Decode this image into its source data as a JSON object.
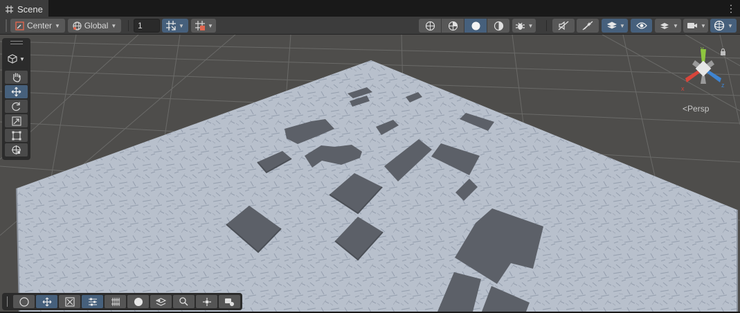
{
  "tab": {
    "label": "Scene",
    "icon": "grid-icon"
  },
  "toolbar": {
    "pivot_label": "Center",
    "space_label": "Global",
    "grid_size_value": "1",
    "icons": [
      "pivot-icon",
      "globe-icon",
      "grid-snap-icon",
      "increment-snap-icon",
      "wireframe-sphere-icon",
      "shaded-wireframe-icon",
      "shaded-sphere-icon",
      "lighting-icon",
      "debug-icon",
      "audio-icon",
      "effects-icon",
      "layers-icon",
      "visibility-icon",
      "overlay-icon",
      "camera-icon",
      "gizmos-icon"
    ]
  },
  "left_tools": [
    "view-tool-hand",
    "move-tool",
    "rotate-tool",
    "scale-tool",
    "rect-tool",
    "transform-tool"
  ],
  "bottom_tools": [
    "navigation-icon",
    "move-icon",
    "scale-icon",
    "align-icon",
    "grid-icon",
    "sphere-icon",
    "layers-icon",
    "search-icon",
    "pivot-icon",
    "camera-icon"
  ],
  "gizmo": {
    "x_label": "x",
    "y_label": "y",
    "z_label": "z",
    "projection_label": "Persp"
  },
  "colors": {
    "accent": "#46607c",
    "viewport_bg": "#4e4d4b",
    "floor": "#b8c0cc",
    "blocks": "#5c6068",
    "x_axis": "#d8453a",
    "y_axis": "#8ec63f",
    "z_axis": "#3f84d1"
  }
}
